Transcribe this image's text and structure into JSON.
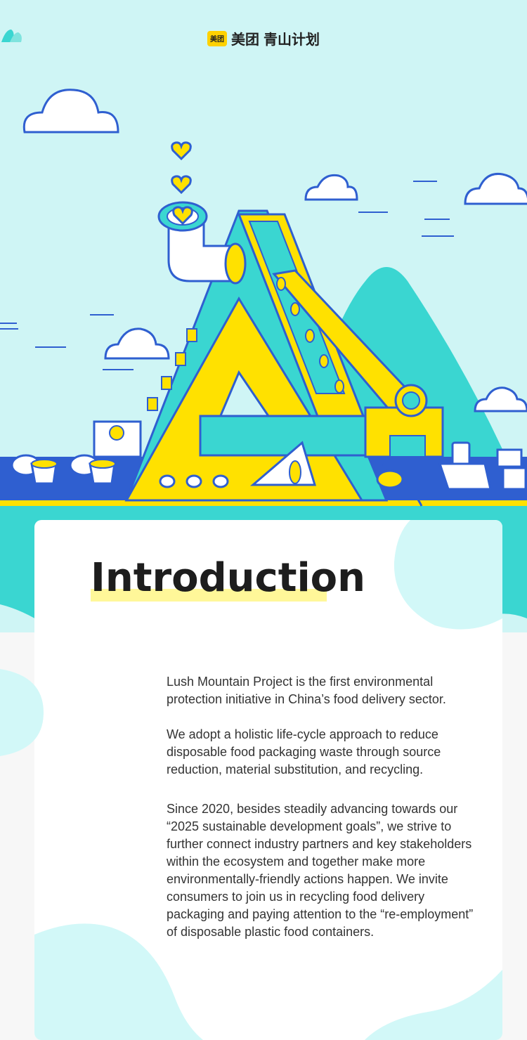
{
  "header": {
    "meituan_badge": "美团",
    "meituan_name": "美团",
    "project_name": "青山计划"
  },
  "icons": [
    "meituan-logo-icon",
    "lush-mountain-logo-icon",
    "cloud-icon",
    "heart-icon",
    "conveyor-icon",
    "takeout-box-icon"
  ],
  "colors": {
    "sky": "#CFF5F5",
    "mountain": "#3AD6D1",
    "accent_yellow": "#FFE100",
    "outline_blue": "#2F5FD0",
    "highlight": "#FFF799"
  },
  "intro": {
    "title": "Introduction",
    "p1": "Lush Mountain Project is the first environmental protection initiative in China’s food delivery sector.",
    "p2": "We adopt a holistic life-cycle approach to reduce disposable food packaging waste through source reduction, material substitution, and recycling.",
    "p3": "Since 2020, besides steadily advancing towards our “2025 sustainable development goals”, we strive to further connect industry partners and key stakeholders within the ecosystem and together make more environmentally-friendly actions happen. We invite consumers to join us in recycling food delivery packaging and paying attention to the “re-employment” of disposable plastic food containers."
  }
}
